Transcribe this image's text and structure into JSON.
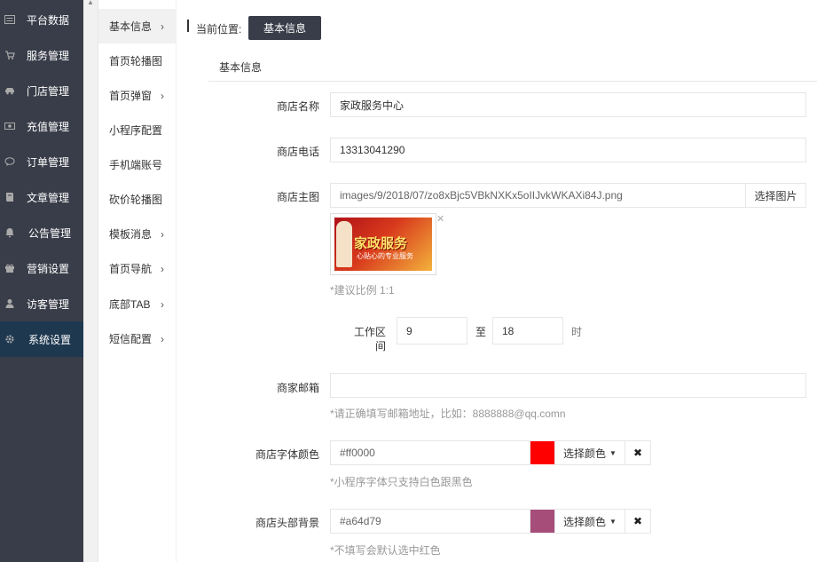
{
  "nav": {
    "items": [
      {
        "label": "平台数据",
        "icon": "dashboard-icon"
      },
      {
        "label": "服务管理",
        "icon": "cart-icon"
      },
      {
        "label": "门店管理",
        "icon": "car-icon"
      },
      {
        "label": "充值管理",
        "icon": "money-icon"
      },
      {
        "label": "订单管理",
        "icon": "comment-icon"
      },
      {
        "label": "文章管理",
        "icon": "book-icon"
      },
      {
        "label": "公告管理",
        "icon": "bell-icon"
      },
      {
        "label": "营销设置",
        "icon": "gift-icon"
      },
      {
        "label": "访客管理",
        "icon": "user-icon"
      },
      {
        "label": "系统设置",
        "icon": "gear-icon",
        "active": true
      }
    ]
  },
  "submenu": {
    "items": [
      {
        "label": "基本信息",
        "arrow": "›",
        "active": true
      },
      {
        "label": "首页轮播图",
        "arrow": ""
      },
      {
        "label": "首页弹窗",
        "arrow": "›"
      },
      {
        "label": "小程序配置",
        "arrow": ""
      },
      {
        "label": "手机端账号",
        "arrow": ""
      },
      {
        "label": "砍价轮播图",
        "arrow": ""
      },
      {
        "label": "模板消息",
        "arrow": "›"
      },
      {
        "label": "首页导航",
        "arrow": "›"
      },
      {
        "label": "底部TAB",
        "arrow": "›"
      },
      {
        "label": "短信配置",
        "arrow": "›"
      }
    ]
  },
  "breadcrumb": {
    "label": "当前位置:",
    "current": "基本信息"
  },
  "section_title": "基本信息",
  "form": {
    "shop_name": {
      "label": "商店名称",
      "value": "家政服务中心"
    },
    "shop_phone": {
      "label": "商店电话",
      "value": "13313041290"
    },
    "shop_image": {
      "label": "商店主图",
      "value": "images/9/2018/07/zo8xBjc5VBkNXKx5oIIJvkWKAXi84J.png",
      "pick_label": "选择图片",
      "hint": "*建议比例 1:1",
      "thumb_title": "家政服务",
      "thumb_subtitle": "心贴心的专业服务"
    },
    "work_hours": {
      "label_line1": "工作区",
      "label_line2": "间",
      "start": "9",
      "to": "至",
      "end": "18",
      "unit": "时"
    },
    "email": {
      "label": "商家邮箱",
      "value": "",
      "hint": "*请正确填写邮箱地址，比如：8888888@qq.comn"
    },
    "font_color": {
      "label": "商店字体颜色",
      "value": "#ff0000",
      "swatch": "#ff0000",
      "pick_label": "选择颜色",
      "hint": "*小程序字体只支持白色跟黑色"
    },
    "header_bg": {
      "label": "商店头部背景",
      "value": "#a64d79",
      "swatch": "#a64d79",
      "pick_label": "选择颜色",
      "hint": "*不填写会默认选中红色"
    }
  }
}
